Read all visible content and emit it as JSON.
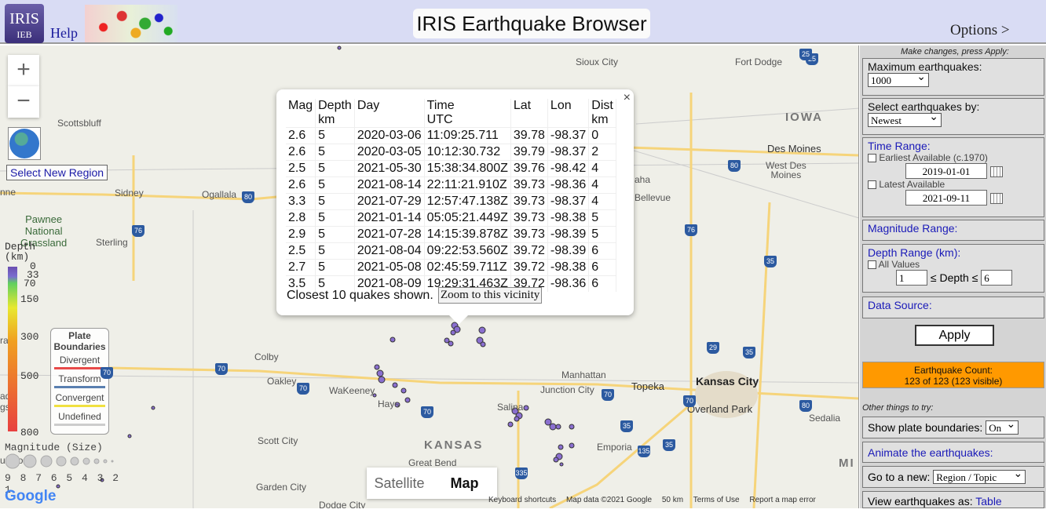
{
  "header": {
    "logo_top": "IRIS",
    "logo_bottom": "IEB",
    "help": "Help",
    "title": "IRIS Earthquake Browser",
    "options": "Options >"
  },
  "map": {
    "controls": {
      "zoom_in": "+",
      "zoom_out": "−",
      "select_region": "Select New Region",
      "satellite": "Satellite",
      "map": "Map"
    },
    "labels": {
      "sioux_city": "Sioux City",
      "fort_dodge": "Fort Dodge",
      "iowa": "IOWA",
      "des_moines": "Des Moines",
      "west_des_moines": "West Des\nMoines",
      "scottsbluff": "Scottsbluff",
      "sidney": "Sidney",
      "ogallala": "Ogallala",
      "pawnee": "Pawnee\nNational\nGrassland",
      "sterling": "Sterling",
      "colby": "Colby",
      "oakley": "Oakley",
      "wakeeney": "WaKeeney",
      "hays": "Hays",
      "kansas": "KANSAS",
      "manhattan": "Manhattan",
      "junction_city": "Junction City",
      "topeka": "Topeka",
      "kansas_city": "Kansas City",
      "overland_park": "Overland Park",
      "salina": "Salina",
      "emporia": "Emporia",
      "great_bend": "Great Bend",
      "garden_city": "Garden City",
      "scott_city": "Scott City",
      "dodge_city": "Dodge City",
      "sedalia": "Sedalia",
      "bellevue": "Bellevue",
      "aha": "aha",
      "mi": "MI",
      "inne": "nne",
      "ra": "ra",
      "ado": "ado",
      "gs": "gs",
      "ueblo": "ueblo"
    },
    "highways": [
      "25",
      "80",
      "80",
      "76",
      "76",
      "70",
      "70",
      "70",
      "70",
      "70",
      "29",
      "35",
      "35",
      "35",
      "335",
      "135",
      "80",
      "35",
      "70",
      "25"
    ],
    "depth_legend": {
      "title": "Depth\n(km)",
      "ticks": [
        "0",
        "33",
        "70",
        "150",
        "300",
        "500",
        "800"
      ]
    },
    "plate_legend": {
      "title": "Plate\nBoundaries",
      "items": [
        "Divergent",
        "Transform",
        "Convergent",
        "Undefined"
      ],
      "colors": [
        "#e84a4a",
        "#5a7fb0",
        "#f0e040",
        "#cccccc"
      ]
    },
    "magnitude_legend": {
      "title": "Magnitude (Size)",
      "scale": "9 8 7 6 5 4 3 2 1"
    },
    "google": "Google",
    "attribution": [
      "Keyboard shortcuts",
      "Map data ©2021 Google",
      "50 km",
      "Terms of Use",
      "Report a map error"
    ]
  },
  "popup": {
    "close": "×",
    "headers": [
      "Mag",
      "Depth\nkm",
      "Day",
      "Time\nUTC",
      "Lat",
      "Lon",
      "Dist\nkm"
    ],
    "rows": [
      [
        "2.6",
        "5",
        "2020-03-06",
        "11:09:25.711",
        "39.78",
        "-98.37",
        "0"
      ],
      [
        "2.6",
        "5",
        "2020-03-05",
        "10:12:30.732",
        "39.79",
        "-98.37",
        "2"
      ],
      [
        "2.5",
        "5",
        "2021-05-30",
        "15:38:34.800Z",
        "39.76",
        "-98.42",
        "4"
      ],
      [
        "2.6",
        "5",
        "2021-08-14",
        "22:11:21.910Z",
        "39.73",
        "-98.36",
        "4"
      ],
      [
        "3.3",
        "5",
        "2021-07-29",
        "12:57:47.138Z",
        "39.73",
        "-98.37",
        "4"
      ],
      [
        "2.8",
        "5",
        "2021-01-14",
        "05:05:21.449Z",
        "39.73",
        "-98.38",
        "5"
      ],
      [
        "2.9",
        "5",
        "2021-07-28",
        "14:15:39.878Z",
        "39.73",
        "-98.39",
        "5"
      ],
      [
        "2.5",
        "5",
        "2021-08-04",
        "09:22:53.560Z",
        "39.72",
        "-98.39",
        "6"
      ],
      [
        "2.7",
        "5",
        "2021-05-08",
        "02:45:59.711Z",
        "39.72",
        "-98.38",
        "6"
      ],
      [
        "3.5",
        "5",
        "2021-08-09",
        "19:29:31.463Z",
        "39.72",
        "-98.36",
        "6"
      ]
    ],
    "footer": "Closest 10 quakes shown.",
    "zoom_button": "Zoom to this vicinity"
  },
  "panel": {
    "hint": "Make changes, press Apply:",
    "max_label": "Maximum earthquakes:",
    "max_value": "1000",
    "select_label": "Select earthquakes by:",
    "select_value": "Newest",
    "time_label": "Time Range:",
    "earliest_label": "Earliest Available (c.1970)",
    "start_date": "2019-01-01",
    "latest_label": "Latest Available",
    "end_date": "2021-09-11",
    "mag_label": "Magnitude Range:",
    "depth_label": "Depth Range (km):",
    "all_values": "All Values",
    "depth_min": "1",
    "depth_mid": "≤ Depth ≤",
    "depth_max": "6",
    "source_label": "Data Source:",
    "apply": "Apply",
    "count_title": "Earthquake Count:",
    "count_value": "123 of 123 (123 visible)",
    "other": "Other things to try:",
    "plates_label": "Show plate boundaries:",
    "plates_value": "On",
    "animate": "Animate the earthquakes:",
    "goto_label": "Go to a new:",
    "goto_value": "Region / Topic",
    "view_label": "View earthquakes as:",
    "view_link": "Table"
  },
  "colors": {
    "header_bg": "#d9dcf4",
    "quake": "#8a6fcf",
    "count_bg": "#ff9900"
  }
}
